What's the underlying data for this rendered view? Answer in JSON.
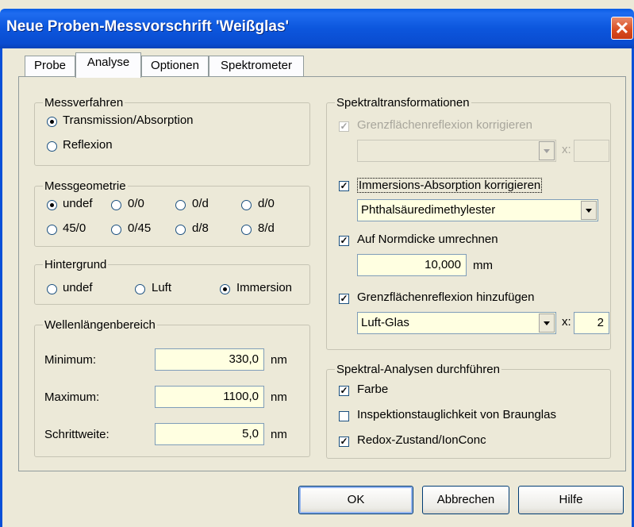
{
  "window": {
    "title": "Neue Proben-Messvorschrift 'Weißglas'",
    "close_glyph": "✕"
  },
  "tabs": [
    {
      "label": "Probe",
      "active": false
    },
    {
      "label": "Analyse",
      "active": true
    },
    {
      "label": "Optionen",
      "active": false
    },
    {
      "label": "Spektrometer",
      "active": false
    }
  ],
  "messverfahren": {
    "title": "Messverfahren",
    "options": [
      {
        "label": "Transmission/Absorption",
        "selected": true
      },
      {
        "label": "Reflexion",
        "selected": false
      }
    ]
  },
  "messgeometrie": {
    "title": "Messgeometrie",
    "options": [
      {
        "label": "undef",
        "selected": true
      },
      {
        "label": "0/0",
        "selected": false
      },
      {
        "label": "0/d",
        "selected": false
      },
      {
        "label": "d/0",
        "selected": false
      },
      {
        "label": "45/0",
        "selected": false
      },
      {
        "label": "0/45",
        "selected": false
      },
      {
        "label": "d/8",
        "selected": false
      },
      {
        "label": "8/d",
        "selected": false
      }
    ]
  },
  "hintergrund": {
    "title": "Hintergrund",
    "options": [
      {
        "label": "undef",
        "selected": false
      },
      {
        "label": "Luft",
        "selected": false
      },
      {
        "label": "Immersion",
        "selected": true
      }
    ]
  },
  "wellenlaengenbereich": {
    "title": "Wellenlängenbereich",
    "minimum": {
      "label": "Minimum:",
      "value": "330,0",
      "unit": "nm"
    },
    "maximum": {
      "label": "Maximum:",
      "value": "1100,0",
      "unit": "nm"
    },
    "schrittweite": {
      "label": "Schrittweite:",
      "value": "5,0",
      "unit": "nm"
    }
  },
  "spektraltransformationen": {
    "title": "Spektraltransformationen",
    "grenzflaeche_korr": {
      "label": "Grenzflächenreflexion korrigieren",
      "checked": true,
      "enabled": false,
      "combo_value": "",
      "x_label": "x:",
      "x_value": ""
    },
    "immersion": {
      "label": "Immersions-Absorption korrigieren",
      "checked": true,
      "combo_value": "Phthalsäuredimethylester"
    },
    "normdicke": {
      "label": "Auf Normdicke umrechnen",
      "checked": true,
      "value": "10,000",
      "unit": "mm"
    },
    "grenzflaeche_add": {
      "label": "Grenzflächenreflexion hinzufügen",
      "checked": true,
      "combo_value": "Luft-Glas",
      "x_label": "x:",
      "x_value": "2"
    }
  },
  "spektralanalysen": {
    "title": "Spektral-Analysen durchführen",
    "items": [
      {
        "label": "Farbe",
        "checked": true
      },
      {
        "label": "Inspektionstauglichkeit von Braunglas",
        "checked": false
      },
      {
        "label": "Redox-Zustand/IonConc",
        "checked": true
      }
    ]
  },
  "buttons": {
    "ok": "OK",
    "cancel": "Abbrechen",
    "help": "Hilfe"
  },
  "glyphs": {
    "check": "✓"
  }
}
